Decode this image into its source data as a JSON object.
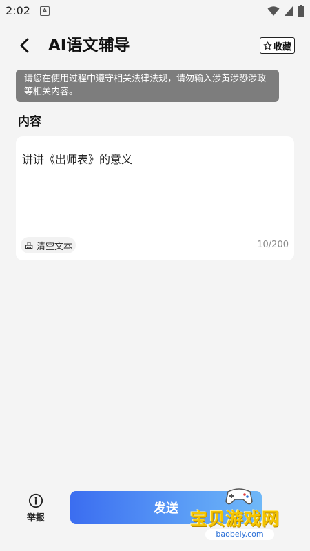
{
  "status_bar": {
    "time": "2:02",
    "app_icon_letter": "A"
  },
  "header": {
    "title": "AI语文辅导",
    "favorite_label": "收藏"
  },
  "notice": {
    "text": "请您在使用过程中遵守相关法律法规，请勿输入涉黄涉恐涉政等相关内容。"
  },
  "content_section": {
    "label": "内容",
    "input_value": "讲讲《出师表》的意义",
    "clear_label": "清空文本",
    "char_count": "10/200"
  },
  "bottom_bar": {
    "report_label": "举报",
    "send_label": "发送"
  },
  "watermark": {
    "name": "宝贝游戏网",
    "url": "baobeiy.com"
  },
  "colors": {
    "notice_bg": "#7d7d7d",
    "send_gradient_start": "#3b6df0",
    "send_gradient_end": "#6fb8f8",
    "watermark_yellow": "#f5c400"
  }
}
